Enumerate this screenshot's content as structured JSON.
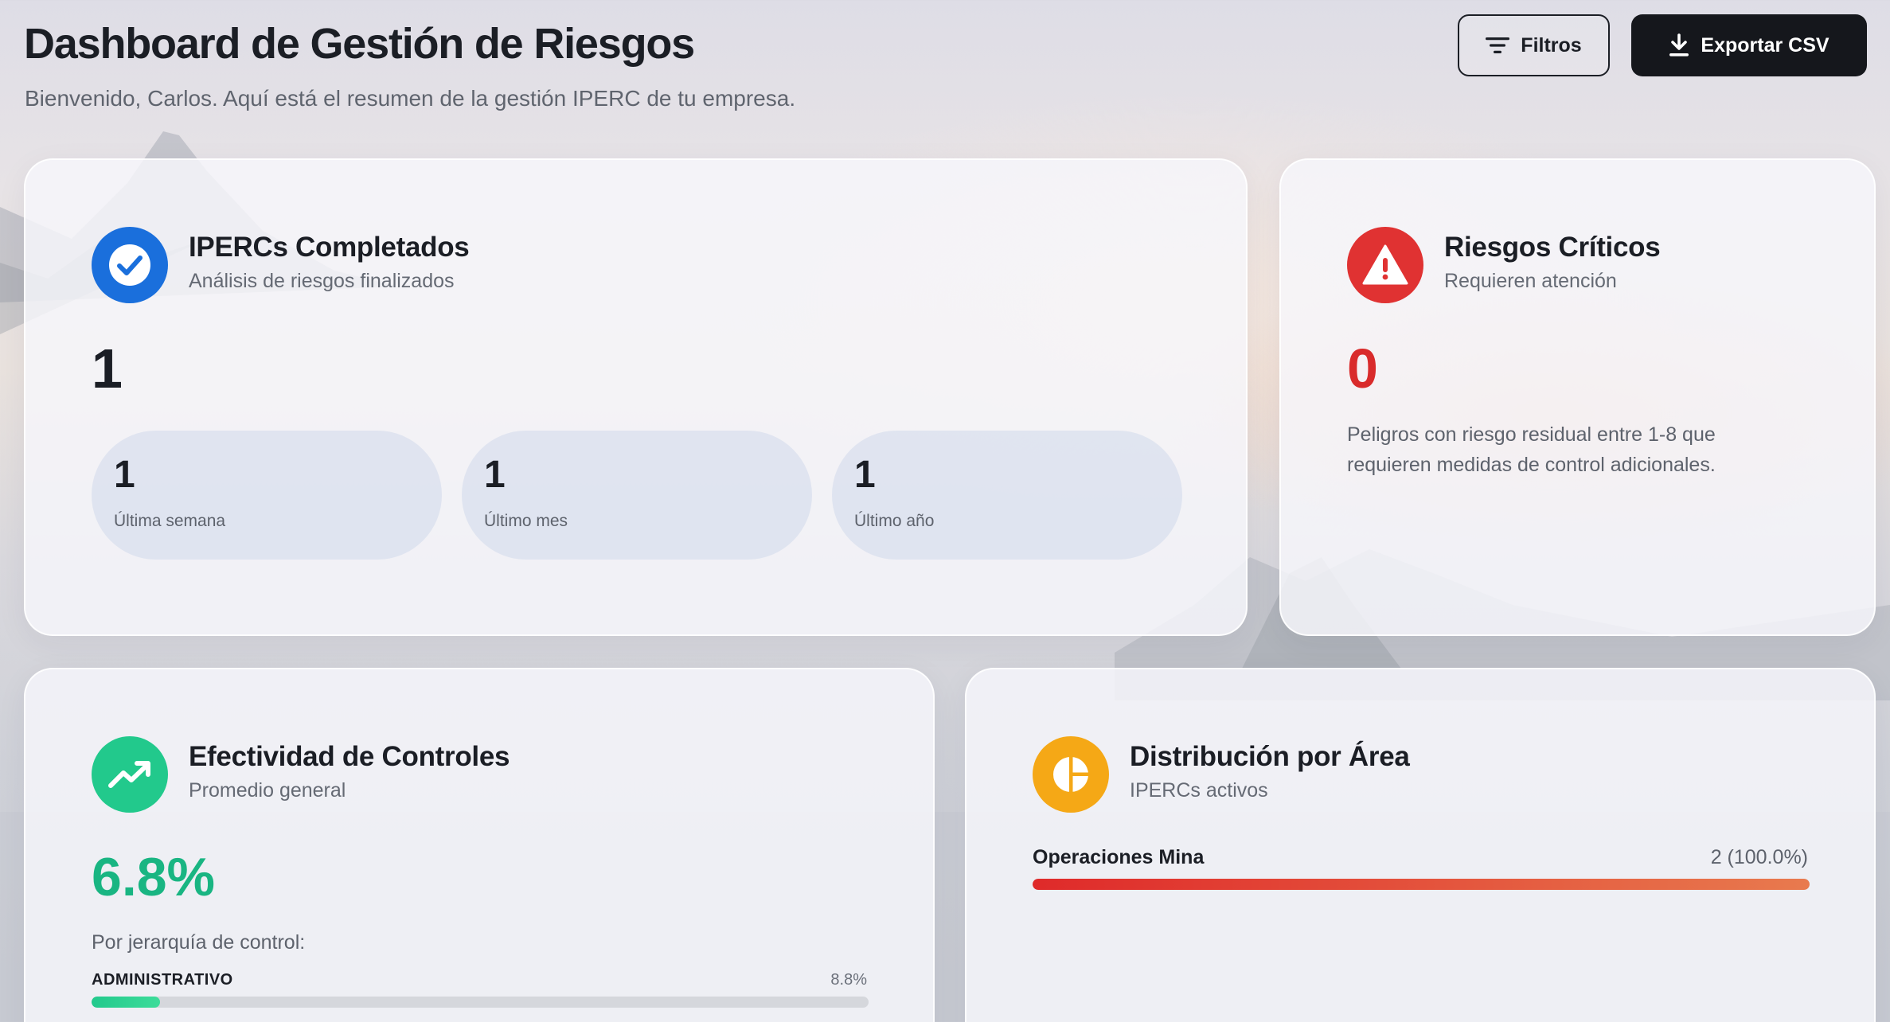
{
  "header": {
    "title": "Dashboard de Gestión de Riesgos",
    "subtitle": "Bienvenido, Carlos. Aquí está el resumen de la gestión IPERC de tu empresa.",
    "filter_label": "Filtros",
    "export_label": "Exportar CSV"
  },
  "ipercs": {
    "icon": "check-circle-icon",
    "title": "IPERCs Completados",
    "desc": "Análisis de riesgos finalizados",
    "total": "1",
    "stats": [
      {
        "value": "1",
        "label": "Última semana"
      },
      {
        "value": "1",
        "label": "Último mes"
      },
      {
        "value": "1",
        "label": "Último año"
      }
    ]
  },
  "criticos": {
    "icon": "warning-triangle-icon",
    "title": "Riesgos Críticos",
    "desc": "Requieren atención",
    "count": "0",
    "note": "Peligros con riesgo residual entre 1-8 que requieren medidas de control adicionales."
  },
  "controles": {
    "icon": "trending-up-icon",
    "title": "Efectividad de Controles",
    "desc": "Promedio general",
    "average": "6.8%",
    "hierarchy_label": "Por jerarquía de control:",
    "rows": [
      {
        "label": "ADMINISTRATIVO",
        "value": "8.8%",
        "fraction": 0.088
      }
    ]
  },
  "distribucion": {
    "icon": "pie-chart-icon",
    "title": "Distribución por Área",
    "desc": "IPERCs activos",
    "areas": [
      {
        "label": "Operaciones Mina",
        "value": "2 (100.0%)",
        "fraction": 1.0
      }
    ]
  },
  "colors": {
    "blue": "#1a6fdc",
    "red": "#e03232",
    "green": "#22c98c",
    "amber": "#f5a816",
    "critical_text": "#d92b2b"
  }
}
